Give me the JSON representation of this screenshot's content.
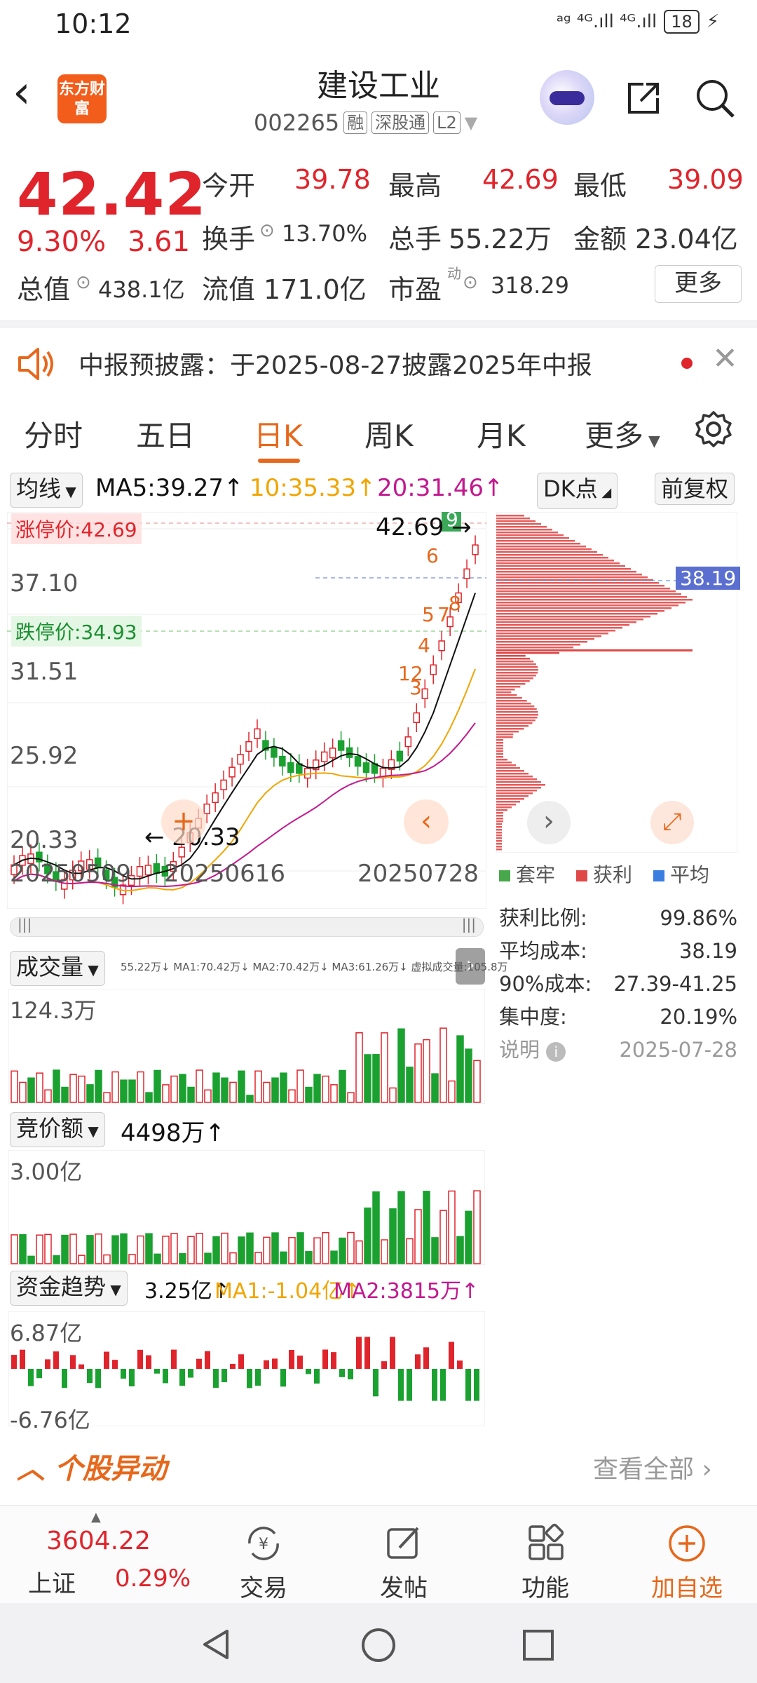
{
  "status_bar": {
    "time": "10:12",
    "signal": "ᵃᵍ ⁴ᴳ.ıll ⁴ᴳ.ıll",
    "battery": "18"
  },
  "header": {
    "logo_text": "东方财富",
    "stock_name": "建设工业",
    "stock_code": "002265",
    "tags": [
      "融",
      "深股通",
      "L2"
    ]
  },
  "quote": {
    "price": "42.42",
    "change_pct": "9.30%",
    "change": "3.61",
    "open_label": "今开",
    "open": "39.78",
    "high_label": "最高",
    "high": "42.69",
    "low_label": "最低",
    "low": "39.09",
    "turnover_label": "换手",
    "turnover": "13.70%",
    "volume_label": "总手",
    "volume": "55.22万",
    "amount_label": "金额",
    "amount": "23.04亿",
    "mktcap_label": "总值",
    "mktcap": "438.1亿",
    "float_label": "流值",
    "float": "171.0亿",
    "pe_label": "市盈",
    "pe_sup": "动",
    "pe": "318.29",
    "more_label": "更多"
  },
  "notice": {
    "text": "中报预披露：于2025-08-27披露2025年中报"
  },
  "tabs": [
    {
      "label": "分时"
    },
    {
      "label": "五日"
    },
    {
      "label": "日K"
    },
    {
      "label": "周K"
    },
    {
      "label": "月K"
    },
    {
      "label": "更多"
    }
  ],
  "kline": {
    "ma_select": "均线",
    "ma5": "MA5:39.27↑",
    "ma10": "10:35.33↑",
    "ma20": "20:31.46↑",
    "dk_label": "DK点",
    "adjust_label": "前复权",
    "limit_up": "涨停价:42.69",
    "limit_down": "跌停价:34.93",
    "y_ticks": [
      "37.10",
      "31.51",
      "25.92",
      "20.33"
    ],
    "high_marker": "42.69",
    "low_marker": "20.33",
    "x_ticks": [
      "20250509",
      "20250616",
      "20250728"
    ],
    "signals": [
      "9",
      "6",
      "5",
      "7",
      "8",
      "4",
      "12",
      "3"
    ],
    "colors": {
      "up": "#e0242b",
      "down": "#1aa130",
      "ma5": "#111111",
      "ma10": "#f0a500",
      "ma20": "#c2198f"
    }
  },
  "chip_panel": {
    "avg_cost_tag": "38.19",
    "legend": [
      "套牢",
      "获利",
      "平均"
    ],
    "rows": [
      {
        "label": "获利比例:",
        "value": "99.86%"
      },
      {
        "label": "平均成本:",
        "value": "38.19"
      },
      {
        "label": "90%成本:",
        "value": "27.39-41.25"
      },
      {
        "label": "集中度:",
        "value": "20.19%"
      }
    ],
    "note_label": "说明",
    "date": "2025-07-28"
  },
  "volume_panel": {
    "select": "成交量",
    "legend": "55.22万↓ MA1:70.42万↓ MA2:70.42万↓ MA3:61.26万↓ 虚拟成交量:105.8万",
    "max_label": "124.3万"
  },
  "auction_panel": {
    "select": "竞价额",
    "value": "4498万↑",
    "max_label": "3.00亿"
  },
  "fund_panel": {
    "select": "资金趋势",
    "value": "3.25亿↑",
    "ma1": "MA1:-1.04亿↑",
    "ma2": "MA2:3815万↑",
    "max_label": "6.87亿",
    "min_label": "-6.76亿"
  },
  "abnormal": {
    "title": "个股异动",
    "view_all": "查看全部"
  },
  "bottom_bar": {
    "index_value": "3604.22",
    "index_name": "上证",
    "index_pct": "0.29%",
    "items": [
      {
        "label": "交易"
      },
      {
        "label": "发帖"
      },
      {
        "label": "功能"
      },
      {
        "label": "加自选"
      }
    ]
  }
}
